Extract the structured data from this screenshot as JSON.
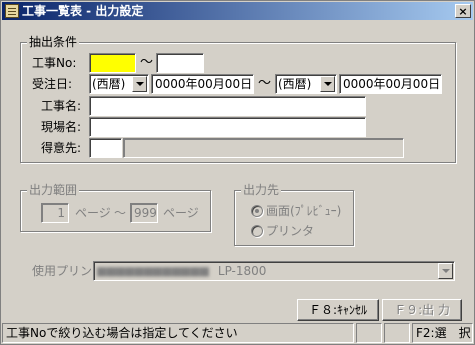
{
  "window": {
    "title": "工事一覧表 - 出力設定",
    "close_label": "×"
  },
  "criteria": {
    "legend": "抽出条件",
    "koji_no_label": "工事No:",
    "koji_no_from": "",
    "koji_no_to": "",
    "tilde": "～",
    "juchu_label": "受注日:",
    "era_from": "(西暦)",
    "date_from": "0000年00月00日",
    "era_to": "(西暦)",
    "date_to": "0000年00月00日",
    "koji_name_label": "工事名:",
    "koji_name_value": "",
    "genba_name_label": "現場名:",
    "genba_name_value": "",
    "tokuisaki_label": "得意先:",
    "tokuisaki_code": "",
    "tokuisaki_name": ""
  },
  "range": {
    "legend": "出力範囲",
    "from_page": "1",
    "page_label_1": "ページ",
    "tilde": "～",
    "to_page": "999",
    "page_label_2": "ページ"
  },
  "output": {
    "legend": "出力先",
    "option_screen": "画面(ﾌﾟﾚﾋﾞｭｰ)",
    "option_printer": "プリンタ",
    "selected": "screen"
  },
  "printer": {
    "label": "使用プリンタ",
    "value_blurred": "■■■■■■■■■■■■",
    "value_model": "LP-1800"
  },
  "buttons": {
    "cancel": "Ｆ８:ｷｬﾝｾﾙ",
    "output": "Ｆ９:出 力"
  },
  "statusbar": {
    "message": "工事Noで絞り込む場合は指定してください",
    "key_hint": "F2:選　択"
  }
}
